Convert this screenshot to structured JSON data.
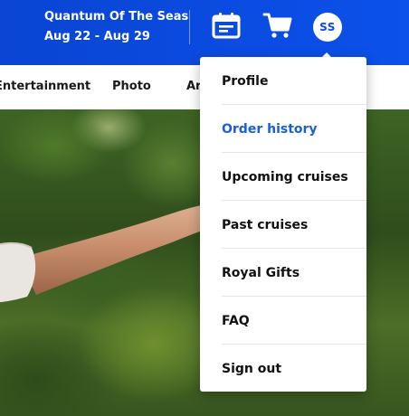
{
  "header": {
    "ship_name": "Quantum Of The Seas",
    "dates": "Aug 22 - Aug 29",
    "calendar_icon": "calendar-icon",
    "cart_icon": "cart-icon",
    "avatar_initials": "SS",
    "colors": {
      "header_blue": "#0b4be0",
      "accent_blue": "#1a5fd7"
    }
  },
  "subnav": {
    "items": [
      "Entertainment",
      "Photo",
      "Ar"
    ]
  },
  "menu": {
    "items": [
      {
        "label": "Profile"
      },
      {
        "label": "Order history",
        "active": true
      },
      {
        "label": "Upcoming cruises"
      },
      {
        "label": "Past cruises"
      },
      {
        "label": "Royal Gifts"
      },
      {
        "label": "FAQ"
      },
      {
        "label": "Sign out"
      }
    ]
  }
}
